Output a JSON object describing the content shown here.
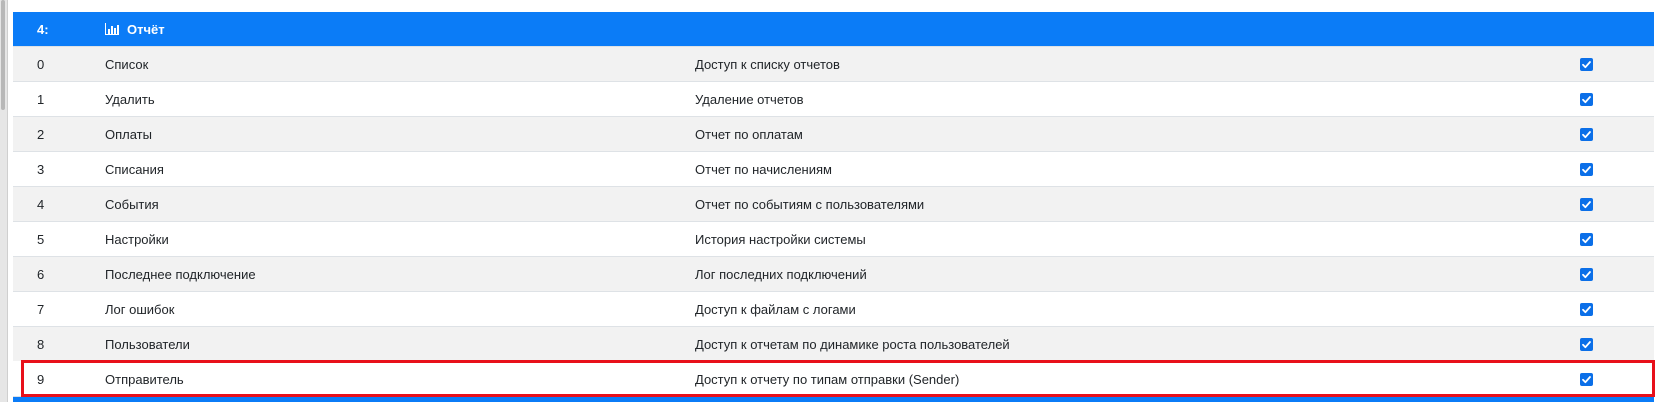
{
  "group": {
    "number": "4:",
    "title": "Отчёт",
    "icon": "bar-chart-icon"
  },
  "rows": [
    {
      "num": "0",
      "name": "Список",
      "desc": "Доступ к списку отчетов",
      "checked": true
    },
    {
      "num": "1",
      "name": "Удалить",
      "desc": "Удаление отчетов",
      "checked": true
    },
    {
      "num": "2",
      "name": "Оплаты",
      "desc": "Отчет по оплатам",
      "checked": true
    },
    {
      "num": "3",
      "name": "Списания",
      "desc": "Отчет по начислениям",
      "checked": true
    },
    {
      "num": "4",
      "name": "События",
      "desc": "Отчет по событиям с пользователями",
      "checked": true
    },
    {
      "num": "5",
      "name": "Настройки",
      "desc": "История настройки системы",
      "checked": true
    },
    {
      "num": "6",
      "name": "Последнее подключение",
      "desc": "Лог последних подключений",
      "checked": true
    },
    {
      "num": "7",
      "name": "Лог ошибок",
      "desc": "Доступ к файлам с логами",
      "checked": true
    },
    {
      "num": "8",
      "name": "Пользователи",
      "desc": "Доступ к отчетам по динамике роста пользователей",
      "checked": true
    },
    {
      "num": "9",
      "name": "Отправитель",
      "desc": "Доступ к отчету по типам отправки (Sender)",
      "checked": true
    }
  ],
  "colors": {
    "header": "#0b7cf7",
    "checkbox": "#0b6fe8",
    "highlight": "#e8101a",
    "row_alt": "#f2f2f2"
  }
}
